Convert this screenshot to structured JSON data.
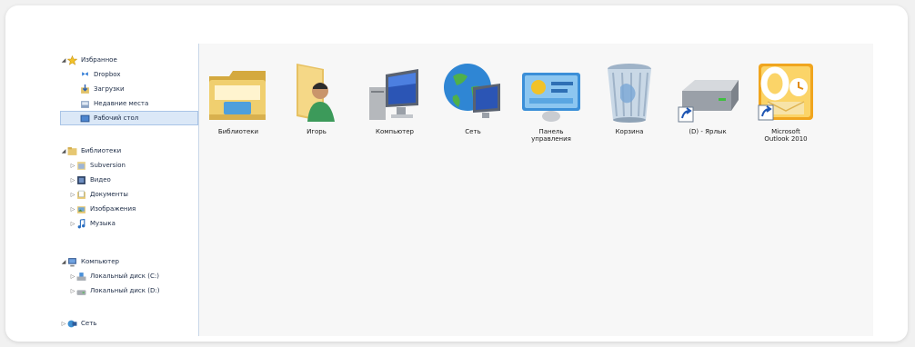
{
  "sidebar": {
    "favorites": {
      "label": "Избранное",
      "items": [
        {
          "label": "Dropbox"
        },
        {
          "label": "Загрузки"
        },
        {
          "label": "Недавние места"
        },
        {
          "label": "Рабочий стол"
        }
      ]
    },
    "libraries": {
      "label": "Библиотеки",
      "items": [
        {
          "label": "Subversion"
        },
        {
          "label": "Видео"
        },
        {
          "label": "Документы"
        },
        {
          "label": "Изображения"
        },
        {
          "label": "Музыка"
        }
      ]
    },
    "computer": {
      "label": "Компьютер",
      "items": [
        {
          "label": "Локальный диск (C:)"
        },
        {
          "label": "Локальный диск (D:)"
        }
      ]
    },
    "network": {
      "label": "Сеть"
    }
  },
  "desktop": {
    "items": [
      {
        "label": "Библиотеки",
        "icon": "libraries-folder-icon"
      },
      {
        "label": "Игорь",
        "icon": "user-folder-icon"
      },
      {
        "label": "Компьютер",
        "icon": "computer-icon"
      },
      {
        "label": "Сеть",
        "icon": "network-globe-icon"
      },
      {
        "label": "Панель\nуправления",
        "icon": "control-panel-icon"
      },
      {
        "label": "Корзина",
        "icon": "recycle-bin-icon"
      },
      {
        "label": "(D) - Ярлык",
        "icon": "drive-shortcut-icon"
      },
      {
        "label": "Microsoft\nOutlook 2010",
        "icon": "outlook-shortcut-icon"
      }
    ]
  }
}
